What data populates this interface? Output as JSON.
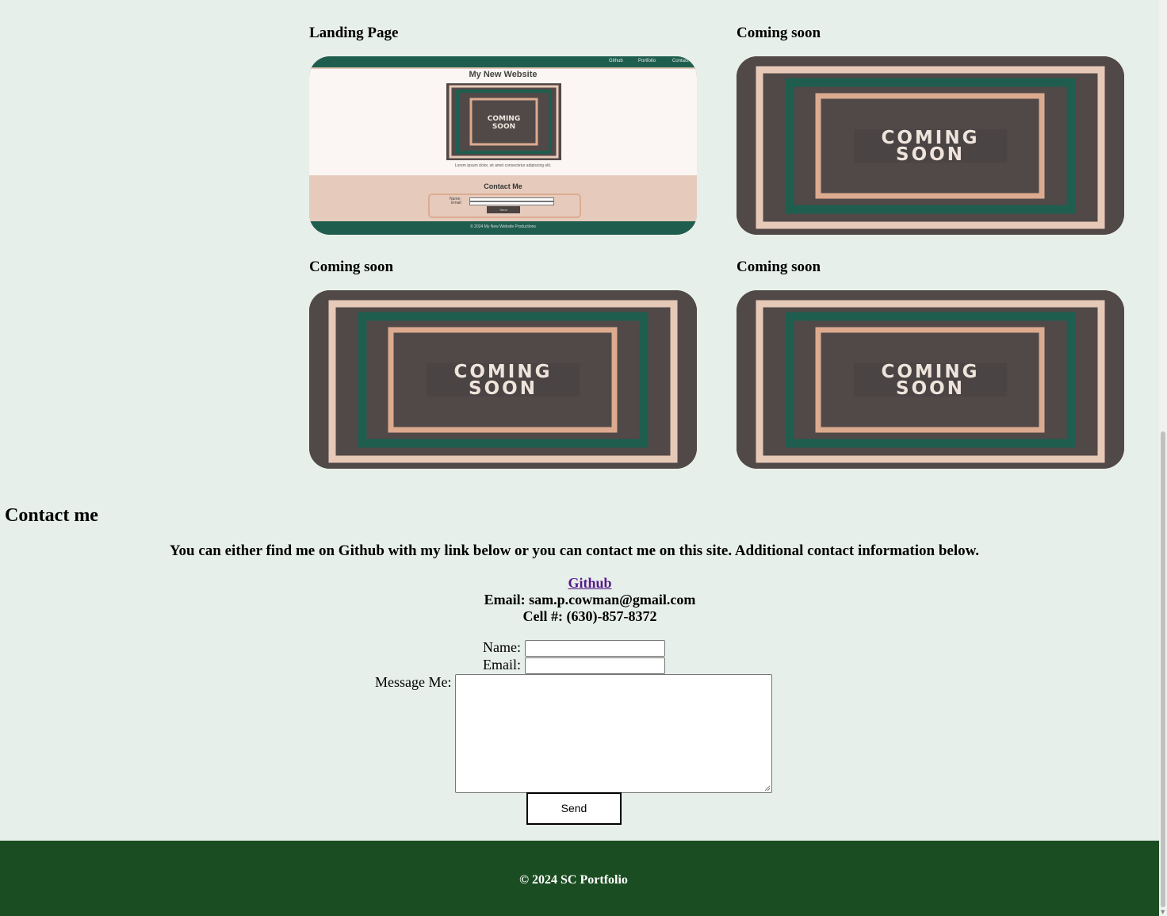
{
  "projects": [
    {
      "title": "Landing Page",
      "thumb": "landing"
    },
    {
      "title": "Coming soon",
      "thumb": "coming-soon",
      "thumb_text": [
        "COMING",
        "SOON"
      ]
    },
    {
      "title": "Coming soon",
      "thumb": "coming-soon",
      "thumb_text": [
        "COMING",
        "SOON"
      ]
    },
    {
      "title": "Coming soon",
      "thumb": "coming-soon",
      "thumb_text": [
        "COMING",
        "SOON"
      ]
    }
  ],
  "landing_thumb": {
    "nav": [
      "Github",
      "Portfolio",
      "Contact"
    ],
    "title": "My New Website",
    "image_text": [
      "COMING",
      "SOON"
    ],
    "lorem": "Lorem ipsum dolor, sit amet consectetur adipiscing elit.",
    "contact_title": "Contact Me",
    "name_label": "Name:",
    "email_label": "Email:",
    "send_label": "Send",
    "footer": "© 2024 My New Website Productions"
  },
  "contact": {
    "heading": "Contact me",
    "intro": "You can either find me on Github with my link below or you can contact me on this site. Additional contact information below.",
    "github_label": "Github",
    "email_line": "Email: sam.p.cowman@gmail.com",
    "cell_line": "Cell #: (630)-857-8372",
    "form": {
      "name_label": "Name:",
      "email_label": "Email:",
      "message_label": "Message Me:",
      "name_value": "",
      "email_value": "",
      "message_value": "",
      "send_label": "Send"
    }
  },
  "footer": {
    "text": "© 2024 SC Portfolio"
  },
  "colors": {
    "page_bg": "#e7efea",
    "footer_bg": "#1b4d22",
    "thumb_dark": "#514848",
    "thumb_green": "#1f5e4f",
    "thumb_peach": "#e7c9b8",
    "thumb_tan": "#dcab8f",
    "link": "#551a8b"
  }
}
